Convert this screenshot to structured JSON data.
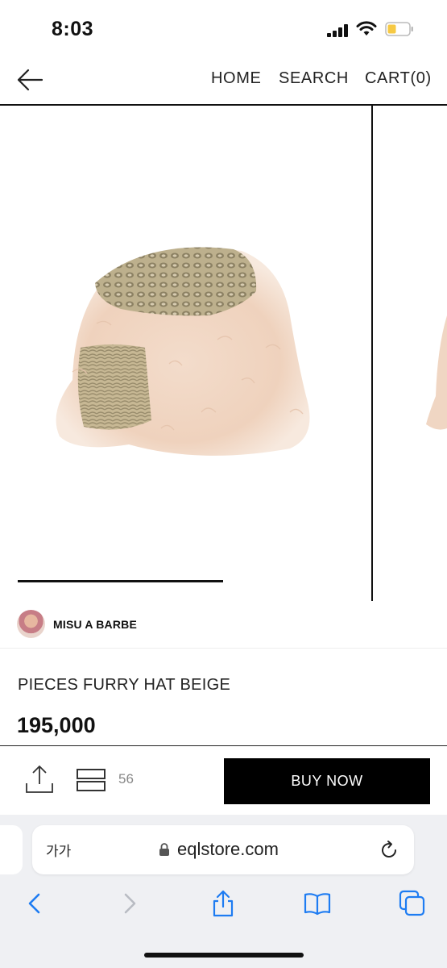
{
  "status_bar": {
    "time": "8:03"
  },
  "nav": {
    "home": "HOME",
    "search": "SEARCH",
    "cart": "CART(0)"
  },
  "brand": {
    "name": "MISU A BARBE"
  },
  "product": {
    "title": "PIECES FURRY HAT BEIGE",
    "price": "195,000"
  },
  "actions": {
    "wishlist_count": "56",
    "buy_label": "BUY NOW"
  },
  "browser": {
    "text_size_label": "가가",
    "url": "eqlstore.com"
  },
  "icons": {
    "back": "arrow-left-icon",
    "share": "share-icon",
    "wishlist": "wishlist-icon",
    "lock": "lock-icon",
    "reload": "reload-icon",
    "bookmarks": "book-icon",
    "tabs": "tabs-icon"
  },
  "colors": {
    "accent": "#000000",
    "safari_accent": "#1e7cf2",
    "browser_bg": "#eff0f3"
  }
}
